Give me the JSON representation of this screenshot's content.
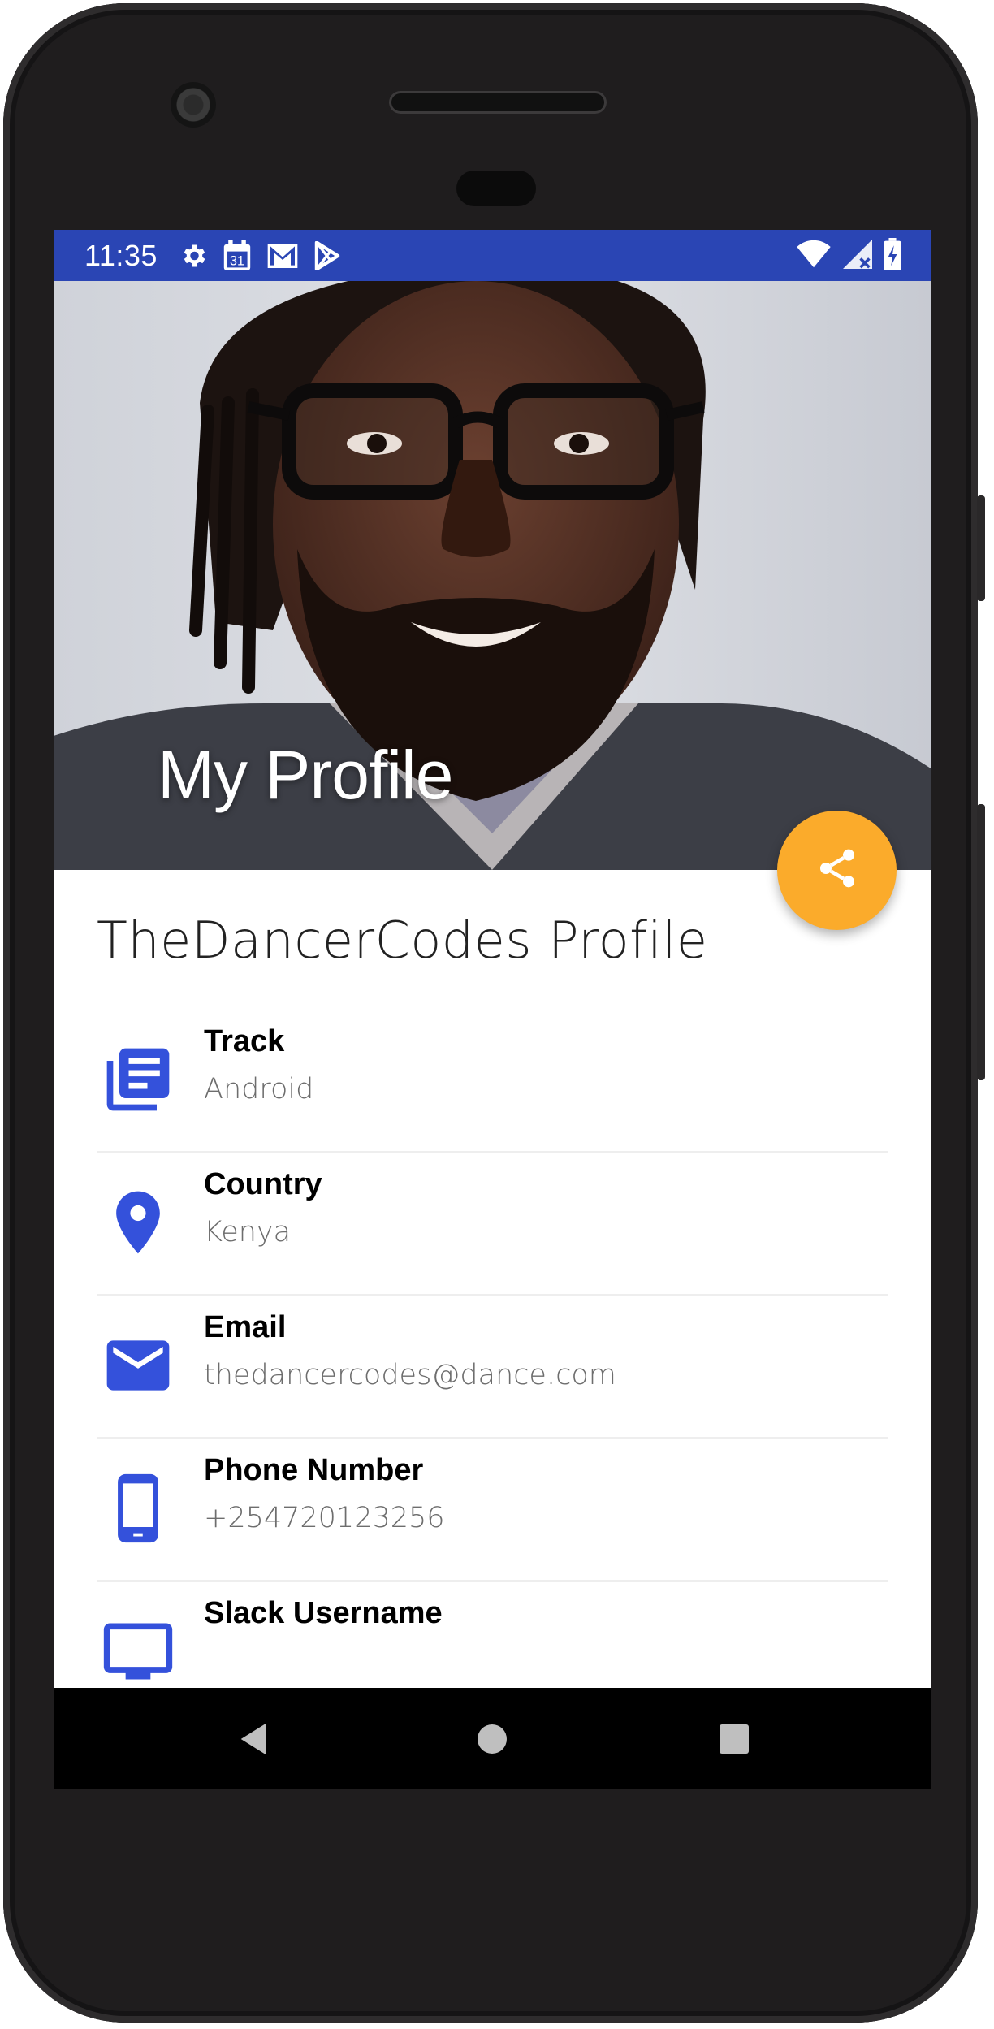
{
  "status_bar": {
    "time": "11:35",
    "left_icons": [
      "gear-icon",
      "calendar-icon",
      "gmail-icon",
      "play-store-icon"
    ],
    "right_icons": [
      "wifi-icon",
      "cell-signal-icon",
      "battery-icon"
    ],
    "calendar_day": "31",
    "color": "#2a45b4"
  },
  "header": {
    "title": "My Profile"
  },
  "fab": {
    "icon": "share-icon",
    "color": "#fbab2b"
  },
  "profile": {
    "heading": "TheDancerCodes Profile",
    "items": [
      {
        "label": "Track",
        "value": "Android",
        "icon": "track-list-icon"
      },
      {
        "label": "Country",
        "value": "Kenya",
        "icon": "location-pin-icon"
      },
      {
        "label": "Email",
        "value": "thedancercodes@dance.com",
        "icon": "email-icon"
      },
      {
        "label": "Phone Number",
        "value": "+254720123256",
        "icon": "phone-icon"
      },
      {
        "label": "Slack Username",
        "value": "",
        "icon": "slack-icon"
      }
    ],
    "icon_color": "#3451db"
  },
  "nav_bar": {
    "buttons": [
      "back-icon",
      "home-icon",
      "recents-icon"
    ]
  }
}
